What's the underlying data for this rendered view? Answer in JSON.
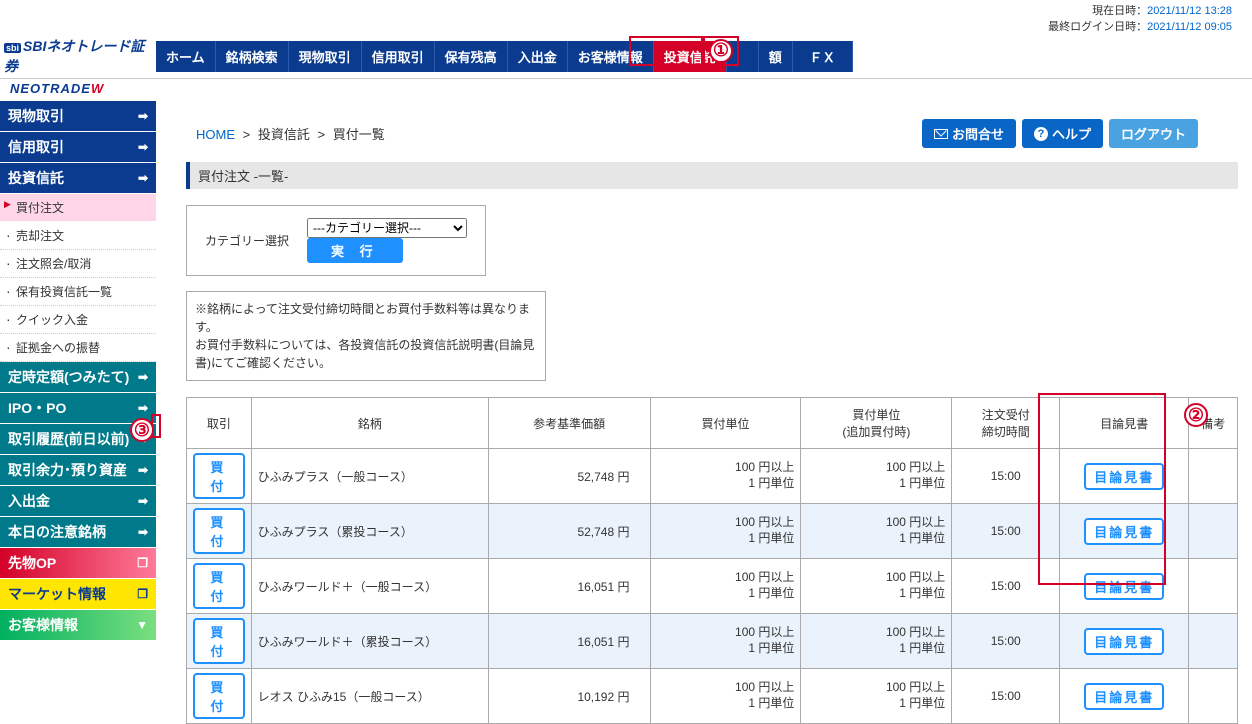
{
  "top": {
    "now_label": "現在日時：",
    "now_value": "2021/11/12 13:28",
    "login_label": "最終ログイン日時：",
    "login_value": "2021/11/12 09:05"
  },
  "logo": {
    "brand": "SBIネオトレード証券",
    "sub": "NEOTRADE",
    "subW": "W"
  },
  "gnav": [
    "ホーム",
    "銘柄検索",
    "現物取引",
    "信用取引",
    "保有残高",
    "入出金",
    "お客様情報",
    "投資信託",
    "",
    "額",
    "ＦＸ"
  ],
  "markers": {
    "m1": "①",
    "m2": "②",
    "m3": "③"
  },
  "sidebar": {
    "heads": {
      "genbutsu": "現物取引",
      "shinyou": "信用取引",
      "toushin": "投資信託",
      "teiji": "定時定額(つみたて)",
      "ipo": "IPO・PO",
      "rireki": "取引履歴(前日以前)",
      "yoryoku": "取引余力･預り資産",
      "nyushukkin": "入出金",
      "today": "本日の注意銘柄",
      "futures": "先物OP",
      "market": "マーケット情報",
      "customer": "お客様情報"
    },
    "subs": [
      "買付注文",
      "売却注文",
      "注文照会/取消",
      "保有投資信託一覧",
      "クイック入金",
      "証拠金への振替"
    ]
  },
  "breadcrumb": {
    "home": "HOME",
    "sep": ">",
    "l1": "投資信託",
    "l2": "買付一覧"
  },
  "buttons": {
    "contact": "お問合せ",
    "help": "ヘルプ",
    "logout": "ログアウト"
  },
  "section_title": "買付注文 -一覧-",
  "cat": {
    "label": "カテゴリー選択",
    "option": "---カテゴリー選択---",
    "exec": "実 行"
  },
  "note": "※銘柄によって注文受付締切時間とお買付手数料等は異なります。\nお買付手数料については、各投資信託の投資信託説明書(目論見書)にてご確認ください。",
  "table": {
    "headers": [
      "取引",
      "銘柄",
      "参考基準価額",
      "買付単位",
      "買付単位\n(追加買付時)",
      "注文受付\n締切時間",
      "目論見書",
      "備考"
    ],
    "buy": "買付",
    "pros": "目論見書",
    "rows": [
      {
        "name": "ひふみプラス（一般コース）",
        "price": "52,748 円",
        "unit1a": "100 円以上",
        "unit1b": "1 円単位",
        "unit2a": "100 円以上",
        "unit2b": "1 円単位",
        "time": "15:00"
      },
      {
        "name": "ひふみプラス（累投コース）",
        "price": "52,748 円",
        "unit1a": "100 円以上",
        "unit1b": "1 円単位",
        "unit2a": "100 円以上",
        "unit2b": "1 円単位",
        "time": "15:00"
      },
      {
        "name": "ひふみワールド＋（一般コース）",
        "price": "16,051 円",
        "unit1a": "100 円以上",
        "unit1b": "1 円単位",
        "unit2a": "100 円以上",
        "unit2b": "1 円単位",
        "time": "15:00"
      },
      {
        "name": "ひふみワールド＋（累投コース）",
        "price": "16,051 円",
        "unit1a": "100 円以上",
        "unit1b": "1 円単位",
        "unit2a": "100 円以上",
        "unit2b": "1 円単位",
        "time": "15:00"
      },
      {
        "name": "レオス ひふみ15（一般コース）",
        "price": "10,192 円",
        "unit1a": "100 円以上",
        "unit1b": "1 円単位",
        "unit2a": "100 円以上",
        "unit2b": "1 円単位",
        "time": "15:00"
      }
    ]
  }
}
